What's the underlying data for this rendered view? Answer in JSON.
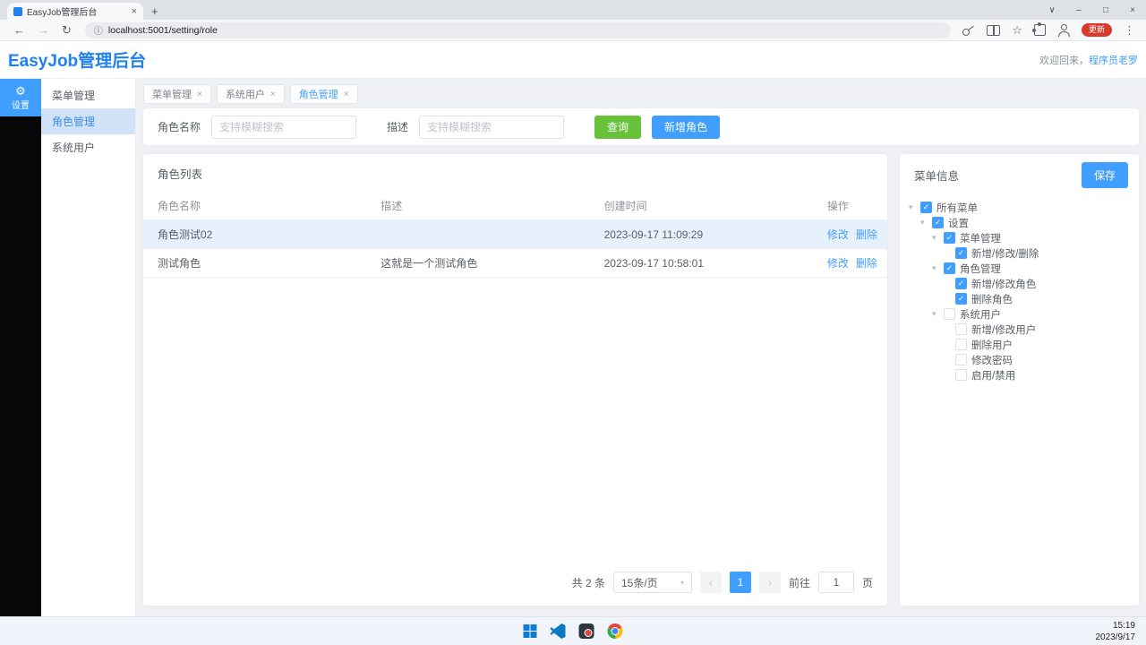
{
  "browser": {
    "tab_title": "EasyJob管理后台",
    "url": "localhost:5001/setting/role",
    "update_button": "更新"
  },
  "icons": {
    "back": "←",
    "forward": "→",
    "refresh": "↻",
    "info": "ⓘ",
    "plus": "+",
    "close": "×",
    "minimize": "–",
    "maximize": "□",
    "chevron_down": "∨",
    "star": "☆",
    "dots": "⋮",
    "gear": "⚙",
    "caret_down": "▾",
    "check": "✓",
    "prev": "‹",
    "next": "›",
    "select_caret": "▾"
  },
  "header": {
    "title": "EasyJob管理后台",
    "welcome_prefix": "欢迎回来，",
    "username": "程序员老罗"
  },
  "sidebar": {
    "rail_label": "设置",
    "items": [
      {
        "label": "菜单管理",
        "active": false
      },
      {
        "label": "角色管理",
        "active": true
      },
      {
        "label": "系统用户",
        "active": false
      }
    ]
  },
  "tabs": [
    {
      "label": "菜单管理",
      "active": false
    },
    {
      "label": "系统用户",
      "active": false
    },
    {
      "label": "角色管理",
      "active": true
    }
  ],
  "search": {
    "name_label": "角色名称",
    "name_placeholder": "支持模糊搜索",
    "desc_label": "描述",
    "desc_placeholder": "支持模糊搜索",
    "query_button": "查询",
    "add_button": "新增角色"
  },
  "table": {
    "title": "角色列表",
    "columns": [
      "角色名称",
      "描述",
      "创建时间",
      "操作"
    ],
    "rows": [
      {
        "name": "角色测试02",
        "desc": "",
        "created": "2023-09-17 11:09:29",
        "highlighted": true
      },
      {
        "name": "测试角色",
        "desc": "这就是一个测试角色",
        "created": "2023-09-17 10:58:01",
        "highlighted": false
      }
    ],
    "actions": {
      "edit": "修改",
      "delete": "删除"
    },
    "pagination": {
      "total": "共 2 条",
      "page_size": "15条/页",
      "current_page": "1",
      "goto_prefix": "前往",
      "goto_value": "1",
      "goto_suffix": "页"
    }
  },
  "menu_panel": {
    "title": "菜单信息",
    "save_button": "保存",
    "tree": [
      {
        "label": "所有菜单",
        "level": 0,
        "checked": true,
        "expandable": true
      },
      {
        "label": "设置",
        "level": 1,
        "checked": true,
        "expandable": true
      },
      {
        "label": "菜单管理",
        "level": 2,
        "checked": true,
        "expandable": true
      },
      {
        "label": "新增/修改/删除",
        "level": 3,
        "checked": true,
        "expandable": false
      },
      {
        "label": "角色管理",
        "level": 2,
        "checked": true,
        "expandable": true
      },
      {
        "label": "新增/修改角色",
        "level": 3,
        "checked": true,
        "expandable": false
      },
      {
        "label": "删除角色",
        "level": 3,
        "checked": true,
        "expandable": false
      },
      {
        "label": "系统用户",
        "level": 2,
        "checked": false,
        "expandable": true
      },
      {
        "label": "新增/修改用户",
        "level": 3,
        "checked": false,
        "expandable": false
      },
      {
        "label": "删除用户",
        "level": 3,
        "checked": false,
        "expandable": false
      },
      {
        "label": "修改密码",
        "level": 3,
        "checked": false,
        "expandable": false
      },
      {
        "label": "启用/禁用",
        "level": 3,
        "checked": false,
        "expandable": false
      }
    ]
  },
  "taskbar": {
    "time": "15:19",
    "date": "2023/9/17"
  },
  "colors": {
    "primary": "#409EFF",
    "success": "#67C23A",
    "brand_blue": "#2080f0",
    "row_highlight": "#e6f1fc",
    "sidebar_bg": "#070707",
    "page_bg": "#eef0f4",
    "update_red": "#d93a2b"
  }
}
